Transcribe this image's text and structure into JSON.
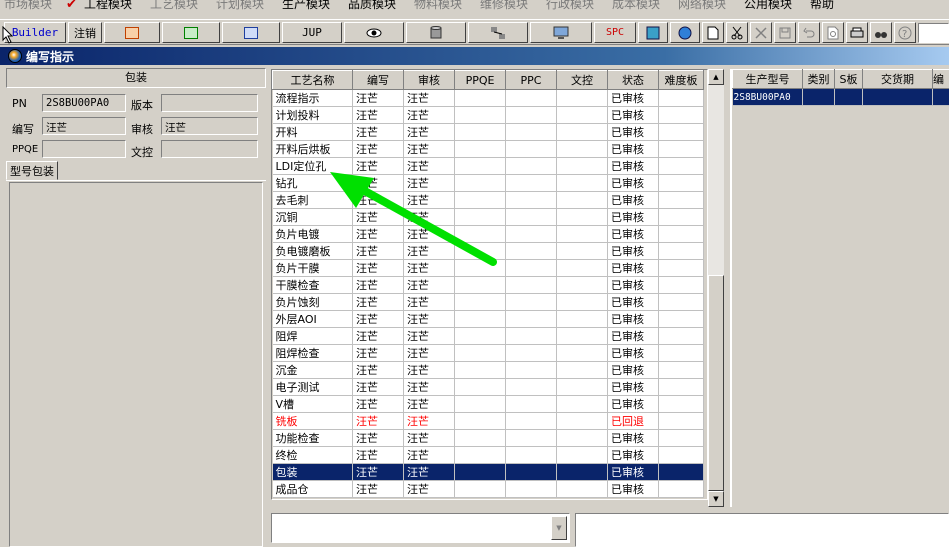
{
  "menubar": {
    "items": [
      "市场模块",
      "工程模块",
      "工艺模块",
      "计划模块",
      "生产模块",
      "品质模块",
      "物料模块",
      "维修模块",
      "行政模块",
      "成本模块",
      "网络模块",
      "公用模块",
      "帮助"
    ],
    "active_index": 1
  },
  "toolbar": {
    "builder": "Builder",
    "logout": "注销",
    "jup": "JUP",
    "spc": "SPC",
    "icons": [
      "ppt-icon",
      "excel-icon",
      "word-icon",
      "eye-icon",
      "cylinder-icon",
      "network-icon",
      "monitor-icon",
      "calculator-icon",
      "globe-icon",
      "new-document-icon",
      "cut-icon",
      "delete-icon",
      "save-icon",
      "undo-icon",
      "preview-icon",
      "print-icon",
      "binoculars-icon",
      "help-icon"
    ]
  },
  "window": {
    "title": "编写指示"
  },
  "left": {
    "header": "包装",
    "pn_label": "PN",
    "pn_value": "2S8BU00PA0",
    "version_label": "版本",
    "version_value": "",
    "writer_label": "编写",
    "writer_value": "汪芒",
    "reviewer_label": "审核",
    "reviewer_value": "汪芒",
    "ppqe_label": "PPQE",
    "ppqe_value": "",
    "doc_control_label": "文控",
    "doc_control_value": "",
    "tab_label": "型号包装"
  },
  "grid": {
    "columns": [
      "工艺名称",
      "编写",
      "审核",
      "PPQE",
      "PPC",
      "文控",
      "状态",
      "难度板"
    ],
    "rows": [
      {
        "name": "流程指示",
        "writer": "汪芒",
        "reviewer": "汪芒",
        "status": "已审核"
      },
      {
        "name": "计划投料",
        "writer": "汪芒",
        "reviewer": "汪芒",
        "status": "已审核"
      },
      {
        "name": "开料",
        "writer": "汪芒",
        "reviewer": "汪芒",
        "status": "已审核"
      },
      {
        "name": "开料后烘板",
        "writer": "汪芒",
        "reviewer": "汪芒",
        "status": "已审核"
      },
      {
        "name": "LDI定位孔",
        "writer": "汪芒",
        "reviewer": "汪芒",
        "status": "已审核"
      },
      {
        "name": "钻孔",
        "writer": "汪芒",
        "reviewer": "汪芒",
        "status": "已审核"
      },
      {
        "name": "去毛刺",
        "writer": "汪芒",
        "reviewer": "汪芒",
        "status": "已审核"
      },
      {
        "name": "沉铜",
        "writer": "汪芒",
        "reviewer": "汪芒",
        "status": "已审核"
      },
      {
        "name": "负片电镀",
        "writer": "汪芒",
        "reviewer": "汪芒",
        "status": "已审核"
      },
      {
        "name": "负电镀磨板",
        "writer": "汪芒",
        "reviewer": "汪芒",
        "status": "已审核"
      },
      {
        "name": "负片干膜",
        "writer": "汪芒",
        "reviewer": "汪芒",
        "status": "已审核"
      },
      {
        "name": "干膜检查",
        "writer": "汪芒",
        "reviewer": "汪芒",
        "status": "已审核"
      },
      {
        "name": "负片蚀刻",
        "writer": "汪芒",
        "reviewer": "汪芒",
        "status": "已审核"
      },
      {
        "name": "外层AOI",
        "writer": "汪芒",
        "reviewer": "汪芒",
        "status": "已审核"
      },
      {
        "name": "阻焊",
        "writer": "汪芒",
        "reviewer": "汪芒",
        "status": "已审核"
      },
      {
        "name": "阻焊检查",
        "writer": "汪芒",
        "reviewer": "汪芒",
        "status": "已审核"
      },
      {
        "name": "沉金",
        "writer": "汪芒",
        "reviewer": "汪芒",
        "status": "已审核"
      },
      {
        "name": "电子测试",
        "writer": "汪芒",
        "reviewer": "汪芒",
        "status": "已审核"
      },
      {
        "name": "V槽",
        "writer": "汪芒",
        "reviewer": "汪芒",
        "status": "已审核"
      },
      {
        "name": "铣板",
        "writer": "汪芒",
        "reviewer": "汪芒",
        "status": "已回退",
        "highlight": "red"
      },
      {
        "name": "功能检查",
        "writer": "汪芒",
        "reviewer": "汪芒",
        "status": "已审核"
      },
      {
        "name": "终检",
        "writer": "汪芒",
        "reviewer": "汪芒",
        "status": "已审核"
      },
      {
        "name": "包装",
        "writer": "汪芒",
        "reviewer": "汪芒",
        "status": "已审核",
        "selected": true
      },
      {
        "name": "成品仓",
        "writer": "汪芒",
        "reviewer": "汪芒",
        "status": "已审核"
      }
    ]
  },
  "right_grid": {
    "columns": [
      "生产型号",
      "类别",
      "S板",
      "交货期",
      "编"
    ],
    "rows": [
      {
        "model": "2S8BU00PA0"
      }
    ]
  },
  "colors": {
    "selection": "#0a246a",
    "reverted": "#ff0000",
    "arrow": "#00e000",
    "face": "#d4d0c8"
  }
}
